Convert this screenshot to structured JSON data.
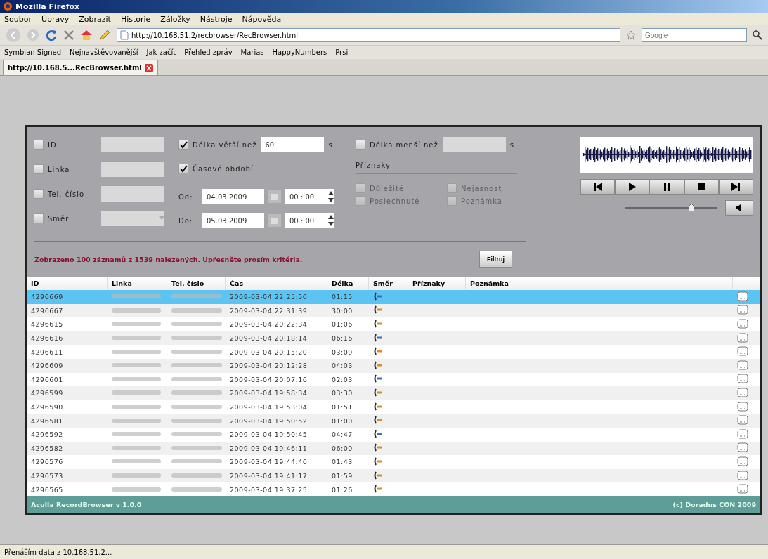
{
  "window": {
    "title": "Mozilla Firefox"
  },
  "menu": [
    "Soubor",
    "Úpravy",
    "Zobrazit",
    "Historie",
    "Záložky",
    "Nástroje",
    "Nápověda"
  ],
  "address": {
    "value": "http://10.168.51.2/recbrowser/RecBrowser.html"
  },
  "search": {
    "placeholder": "Google"
  },
  "bookmarks": [
    "Symbian Signed",
    "Nejnavštěvovanější",
    "Jak začít",
    "Přehled zpráv",
    "Marias",
    "HappyNumbers",
    "Prsi"
  ],
  "tabs": [
    {
      "label": "http://10.168.5...RecBrowser.html",
      "selected": true
    }
  ],
  "filters": {
    "left": [
      {
        "label": "ID",
        "checked": false,
        "kind": "text"
      },
      {
        "label": "Linka",
        "checked": false,
        "kind": "text"
      },
      {
        "label": "Tel. číslo",
        "checked": false,
        "kind": "text"
      },
      {
        "label": "Směr",
        "checked": false,
        "kind": "select"
      }
    ],
    "longer": {
      "label": "Délka větší než",
      "checked": true,
      "value": "60",
      "unit": "s"
    },
    "period": {
      "label": "Časové období",
      "checked": true
    },
    "range": [
      {
        "label": "Od:",
        "date": "04.03.2009",
        "time": "00 : 00"
      },
      {
        "label": "Do:",
        "date": "05.03.2009",
        "time": "00 : 00"
      }
    ],
    "shorter": {
      "label": "Délka menší než",
      "checked": false,
      "unit": "s"
    },
    "flags_title": "Příznaky",
    "flags": [
      {
        "label": "Důležité",
        "checked": false,
        "disabled": true
      },
      {
        "label": "Nejasnost",
        "checked": false,
        "disabled": true
      },
      {
        "label": "Poslechnuté",
        "checked": false,
        "disabled": true
      },
      {
        "label": "Poznámka",
        "checked": false,
        "disabled": true
      }
    ],
    "message": "Zobrazeno 100 záznamů z 1539 nalezených. Upřesněte prosím kritéria.",
    "button": "Filtruj"
  },
  "player": {
    "volume": {
      "level": 0.72
    }
  },
  "table": {
    "columns": [
      "ID",
      "Linka",
      "Tel. číslo",
      "Čas",
      "Délka",
      "Směr",
      "Příznaky",
      "Poznámka"
    ],
    "rows": [
      {
        "id": "4296669",
        "time": "2009-03-04 22:25:50",
        "length": "01:15",
        "color": "#3a6fc0",
        "selected": true
      },
      {
        "id": "4296667",
        "time": "2009-03-04 22:31:39",
        "length": "30:00",
        "color": "#e08a20",
        "selected": false
      },
      {
        "id": "4296615",
        "time": "2009-03-04 20:22:34",
        "length": "01:06",
        "color": "#e08a20",
        "selected": false
      },
      {
        "id": "4296616",
        "time": "2009-03-04 20:18:14",
        "length": "06:16",
        "color": "#3a6fc0",
        "selected": false
      },
      {
        "id": "4296611",
        "time": "2009-03-04 20:15:20",
        "length": "03:09",
        "color": "#e08a20",
        "selected": false
      },
      {
        "id": "4296609",
        "time": "2009-03-04 20:12:28",
        "length": "04:03",
        "color": "#e08a20",
        "selected": false
      },
      {
        "id": "4296601",
        "time": "2009-03-04 20:07:16",
        "length": "02:03",
        "color": "#3a6fc0",
        "selected": false
      },
      {
        "id": "4296599",
        "time": "2009-03-04 19:58:34",
        "length": "03:30",
        "color": "#e08a20",
        "selected": false
      },
      {
        "id": "4296590",
        "time": "2009-03-04 19:53:04",
        "length": "01:51",
        "color": "#e08a20",
        "selected": false
      },
      {
        "id": "4296581",
        "time": "2009-03-04 19:50:52",
        "length": "01:00",
        "color": "#e08a20",
        "selected": false
      },
      {
        "id": "4296592",
        "time": "2009-03-04 19:50:45",
        "length": "04:47",
        "color": "#3a6fc0",
        "selected": false
      },
      {
        "id": "4296582",
        "time": "2009-03-04 19:46:11",
        "length": "06:00",
        "color": "#e08a20",
        "selected": false
      },
      {
        "id": "4296576",
        "time": "2009-03-04 19:44:46",
        "length": "01:43",
        "color": "#e08a20",
        "selected": false
      },
      {
        "id": "4296573",
        "time": "2009-03-04 19:41:17",
        "length": "01:59",
        "color": "#e08a20",
        "selected": false
      },
      {
        "id": "4296565",
        "time": "2009-03-04 19:37:25",
        "length": "01:26",
        "color": "#e08a20",
        "selected": false
      }
    ]
  },
  "footer": {
    "left": "Aculla RecordBrowser v 1.0.0",
    "right": "(c) Doradus CON 2009"
  },
  "status_bar": "Přenáším data z 10.168.51.2..."
}
